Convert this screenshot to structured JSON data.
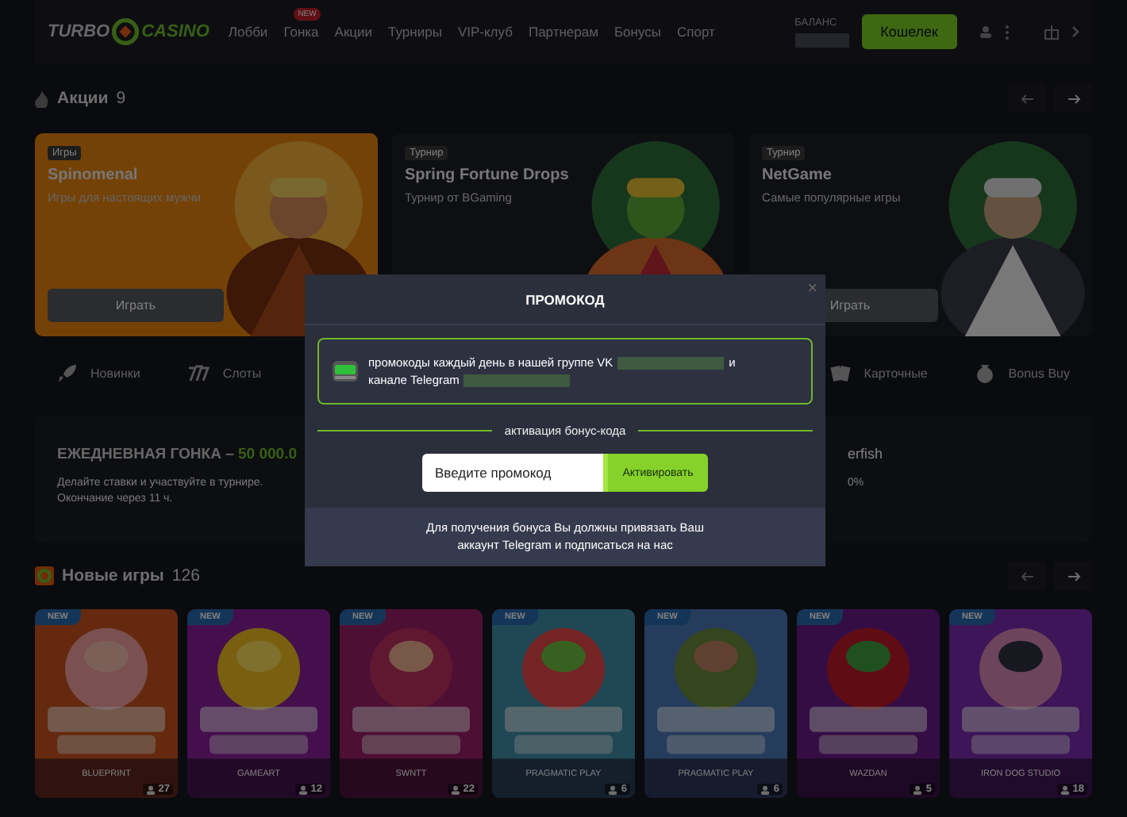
{
  "header": {
    "logo_left": "TURBO",
    "logo_right": "CASINO",
    "nav": [
      {
        "label": "Лобби"
      },
      {
        "label": "Гонка",
        "badge": "NEW"
      },
      {
        "label": "Акции"
      },
      {
        "label": "Турниры"
      },
      {
        "label": "VIP-клуб"
      },
      {
        "label": "Партнерам"
      },
      {
        "label": "Бонусы"
      },
      {
        "label": "Спорт"
      }
    ],
    "balance_label": "БАЛАНС",
    "wallet_button": "Кошелек"
  },
  "promotions": {
    "title": "Акции",
    "count": "9",
    "cards": [
      {
        "tag": "Игры",
        "title": "Spinomenal",
        "subtitle": "Игры для настоящих мужчи",
        "button": "Играть"
      },
      {
        "tag": "Турнир",
        "title": "Spring Fortune Drops",
        "subtitle": "Турнир от BGaming"
      },
      {
        "tag": "Турнир",
        "title": "NetGame",
        "subtitle": "Самые популярные игры",
        "button": "Играть"
      }
    ]
  },
  "categories": [
    {
      "label": "Новинки"
    },
    {
      "label": "Слоты"
    },
    {
      "label": "Карточные"
    },
    {
      "label": "Bonus Buy"
    }
  ],
  "race": {
    "title": "ЕЖЕДНЕВНАЯ ГОНКА – ",
    "prize": "50 000.0",
    "text": "Делайте ставки и участвуйте в турнире.",
    "ends": "Окончание через 11 ч.",
    "side_title": "erfish",
    "side_value": "0%"
  },
  "new_games": {
    "title": "Новые игры",
    "count": "126",
    "games": [
      {
        "badge": "NEW",
        "provider": "BLUEPRINT",
        "players": "27"
      },
      {
        "badge": "NEW",
        "provider": "GAMEART",
        "players": "12"
      },
      {
        "badge": "NEW",
        "provider": "SWNTT",
        "players": "22"
      },
      {
        "badge": "NEW",
        "provider": "PRAGMATIC PLAY",
        "players": "6"
      },
      {
        "badge": "NEW",
        "provider": "PRAGMATIC PLAY",
        "players": "6"
      },
      {
        "badge": "NEW",
        "provider": "WAZDAN",
        "players": "5"
      },
      {
        "badge": "NEW",
        "provider": "IRON DOG STUDIO",
        "players": "18"
      }
    ]
  },
  "modal": {
    "title": "ПРОМОКОД",
    "close": "×",
    "info_before_vk": "промокоды каждый день в нашей группе VK",
    "info_and": "и",
    "info_telegram": "канале Telegram",
    "divider_label": "активация бонус-кода",
    "input": {
      "placeholder": "Введите промокод"
    },
    "activate_button": "Активировать",
    "footer": "Для получения бонуса Вы должны привязать Ваш аккаунт Telegram и подписаться на нас"
  }
}
